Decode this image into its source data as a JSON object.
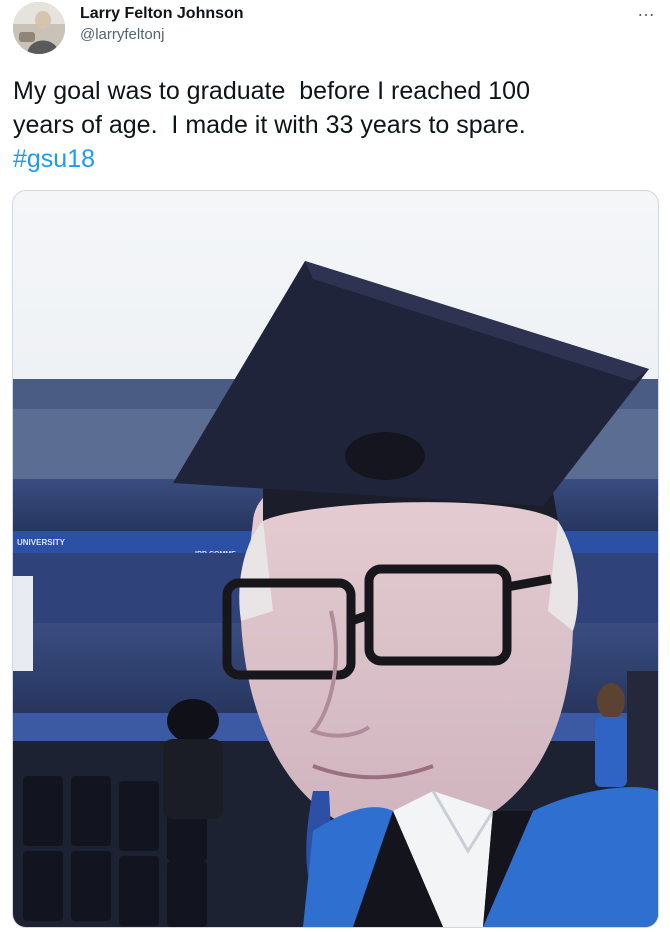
{
  "author": {
    "display_name": "Larry Felton Johnson",
    "handle": "@larryfeltonj"
  },
  "more_icon": "…",
  "tweet": {
    "text_line1": "My goal was to graduate  before I reached 100",
    "text_line2": "years of age.  I made it with 33 years to spare.",
    "hashtag": "#gsu18"
  },
  "photo": {
    "stadium_sign_left": "UNIVERSITY",
    "stadium_sign_right": "IRD COMME"
  },
  "colors": {
    "link": "#1d9bf0",
    "stadium_seats": "#2c3f73",
    "gown_blue": "#2f6fd0",
    "cap": "#1b1d2a"
  }
}
